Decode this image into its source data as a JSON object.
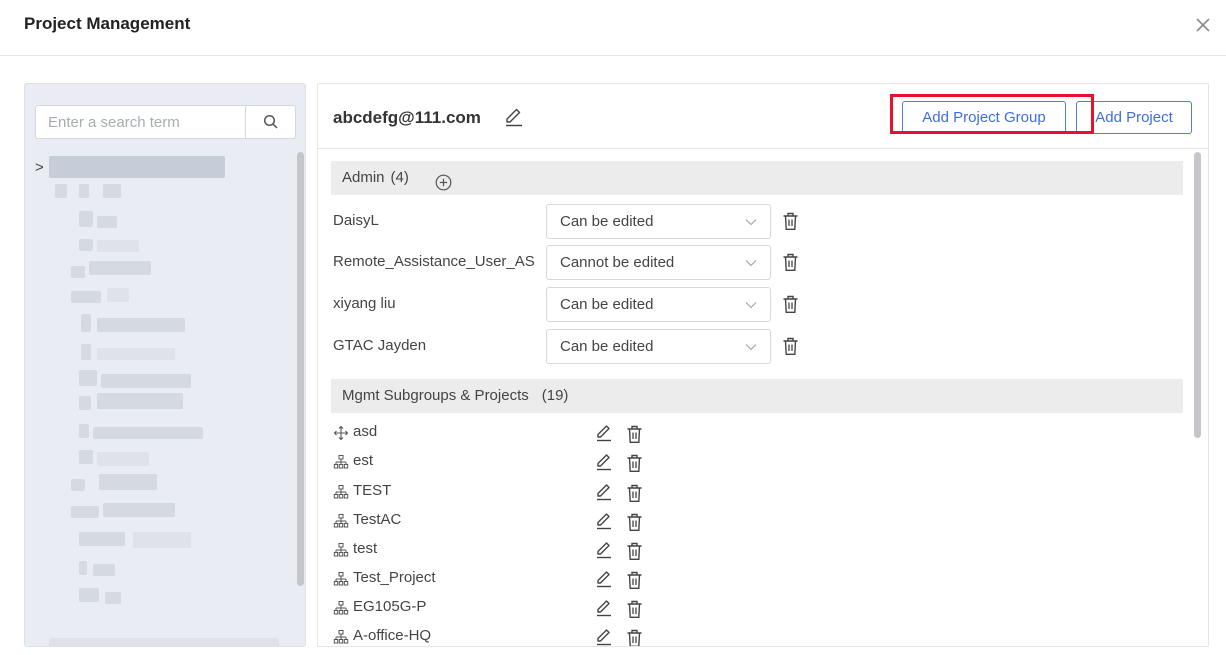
{
  "dialog": {
    "title": "Project Management",
    "close_icon": "close-icon"
  },
  "search": {
    "placeholder": "Enter a search term",
    "value": "",
    "icon": "search-icon"
  },
  "tree": {
    "expand_icon": "chevron-right-icon",
    "expander": ">"
  },
  "account": {
    "email": "abcdefg@111.com",
    "edit_icon": "edit-icon"
  },
  "buttons": {
    "add_project_group": "Add Project Group",
    "add_project": "Add Project"
  },
  "admins": {
    "label": "Admin",
    "count": "(4)",
    "add_icon": "add-circle-icon",
    "rows": [
      {
        "name": "DaisyL",
        "permission": "Can be edited"
      },
      {
        "name": "Remote_Assistance_User_AS",
        "permission": "Cannot be edited"
      },
      {
        "name": "xiyang liu",
        "permission": "Can be edited"
      },
      {
        "name": "GTAC Jayden",
        "permission": "Can be edited"
      }
    ]
  },
  "subgroups": {
    "label": "Mgmt Subgroups & Projects",
    "count": "(19)",
    "items": [
      {
        "name": "asd",
        "icon": "move-icon"
      },
      {
        "name": "est",
        "icon": "hierarchy-icon"
      },
      {
        "name": "TEST",
        "icon": "hierarchy-icon"
      },
      {
        "name": "TestAC",
        "icon": "hierarchy-icon"
      },
      {
        "name": "test",
        "icon": "hierarchy-icon"
      },
      {
        "name": "Test_Project",
        "icon": "hierarchy-icon"
      },
      {
        "name": "EG105G-P",
        "icon": "hierarchy-icon"
      },
      {
        "name": "A-office-HQ",
        "icon": "hierarchy-icon"
      }
    ]
  },
  "colors": {
    "accent": "#3e6ee0",
    "highlight": "#e4122a",
    "section_bg": "#ececec",
    "tree_bg": "#e9ecf3"
  }
}
